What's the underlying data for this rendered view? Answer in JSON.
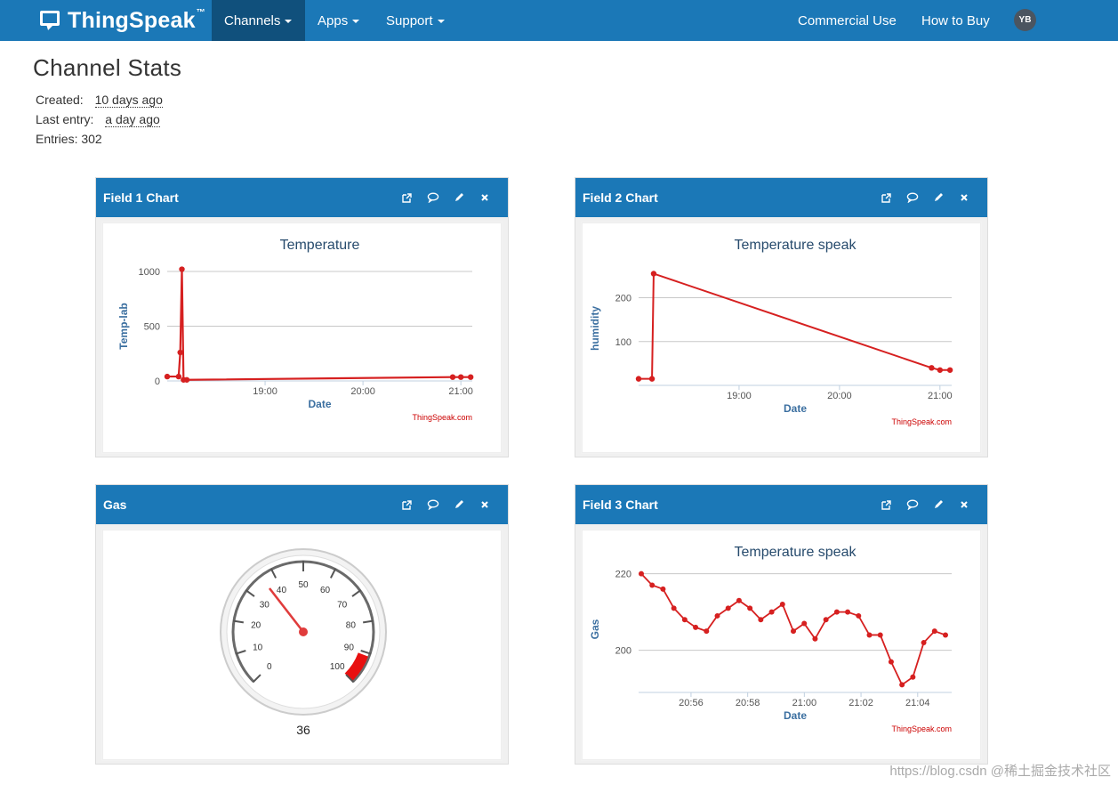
{
  "nav": {
    "brand": "ThingSpeak",
    "brand_tm": "™",
    "items": [
      {
        "label": "Channels"
      },
      {
        "label": "Apps"
      },
      {
        "label": "Support"
      }
    ],
    "right": [
      {
        "label": "Commercial Use"
      },
      {
        "label": "How to Buy"
      }
    ],
    "avatar": "YB"
  },
  "page": {
    "title": "Channel Stats",
    "created_label": "Created:",
    "created_value": "10 days ago",
    "last_entry_label": "Last entry:",
    "last_entry_value": "a day ago",
    "entries": "Entries: 302"
  },
  "panels": {
    "field1": {
      "title": "Field 1 Chart"
    },
    "field2": {
      "title": "Field 2 Chart"
    },
    "gas": {
      "title": "Gas"
    },
    "field3": {
      "title": "Field 3 Chart"
    }
  },
  "credit": "ThingSpeak.com",
  "watermark": "https://blog.csdn @稀土掘金技术社区",
  "colors": {
    "nav": "#1b78b7",
    "series": "#d62020",
    "axis_title": "#3b6fa0"
  },
  "icons": [
    "external-link-icon",
    "comment-icon",
    "pencil-icon",
    "close-icon"
  ],
  "chart_data": [
    {
      "type": "line",
      "title": "Temperature",
      "xlabel": "Date",
      "ylabel": "Temp-lab",
      "x_ticks": [
        "19:00",
        "20:00",
        "21:00"
      ],
      "y_ticks": [
        0,
        500,
        1000
      ],
      "ylim": [
        0,
        1000
      ],
      "grid": true,
      "series": [
        {
          "points": [
            [
              "18:00",
              40
            ],
            [
              "18:07",
              40
            ],
            [
              "18:08",
              260
            ],
            [
              "18:09",
              1020
            ],
            [
              "18:10",
              10
            ],
            [
              "18:12",
              10
            ],
            [
              "20:55",
              35
            ],
            [
              "21:00",
              35
            ],
            [
              "21:06",
              35
            ]
          ]
        }
      ]
    },
    {
      "type": "line",
      "title": "Temperature speak",
      "xlabel": "Date",
      "ylabel": "humidity",
      "x_ticks": [
        "19:00",
        "20:00",
        "21:00"
      ],
      "y_ticks": [
        100,
        200
      ],
      "grid": true,
      "series": [
        {
          "points": [
            [
              "18:00",
              15
            ],
            [
              "18:08",
              15
            ],
            [
              "18:09",
              255
            ],
            [
              "20:55",
              40
            ],
            [
              "21:00",
              35
            ],
            [
              "21:06",
              35
            ]
          ]
        }
      ]
    },
    {
      "type": "gauge",
      "title": "Gas",
      "value": 36,
      "range": [
        0,
        100
      ],
      "tick_labels": [
        "0",
        "10",
        "20",
        "30",
        "40",
        "50",
        "60",
        "70",
        "80",
        "90",
        "100"
      ],
      "red_band": [
        90,
        100
      ]
    },
    {
      "type": "line",
      "title": "Temperature speak",
      "xlabel": "Date",
      "ylabel": "Gas",
      "x_ticks": [
        "20:56",
        "20:58",
        "21:00",
        "21:02",
        "21:04"
      ],
      "y_ticks": [
        200,
        220
      ],
      "grid": true,
      "series": [
        {
          "values": [
            220,
            217,
            216,
            211,
            208,
            206,
            205,
            209,
            211,
            213,
            211,
            208,
            210,
            212,
            205,
            207,
            203,
            208,
            210,
            210,
            209,
            204,
            204,
            197,
            191,
            193,
            202,
            205,
            204
          ]
        }
      ]
    }
  ]
}
